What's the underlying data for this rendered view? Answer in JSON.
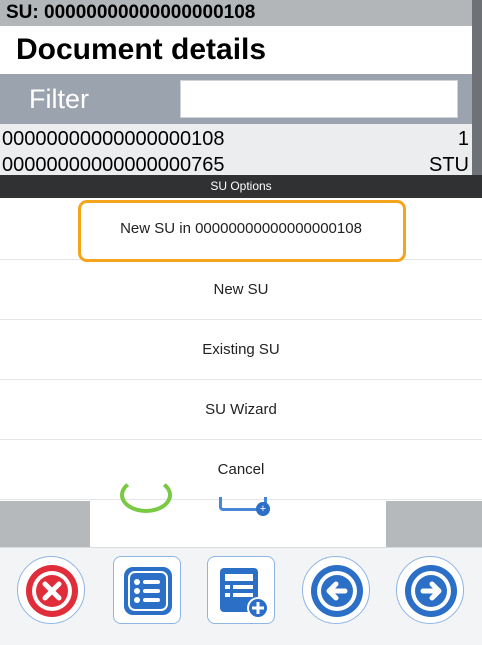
{
  "screen": {
    "su_label": "SU: 00000000000000000108",
    "title": "Document details",
    "filter_label": "Filter",
    "filter_value": "",
    "rows": [
      {
        "id": "00000000000000000108",
        "qty": "1"
      },
      {
        "id": "00000000000000000765",
        "qty": "STU"
      }
    ]
  },
  "dialog": {
    "header": "SU Options",
    "options": [
      {
        "label": "New SU in 00000000000000000108",
        "focused": true
      },
      {
        "label": "New SU"
      },
      {
        "label": "Existing SU"
      },
      {
        "label": "SU Wizard"
      },
      {
        "label": "Cancel"
      }
    ],
    "focus_color": "#f4a51d"
  },
  "toolbar": {
    "buttons": [
      {
        "icon": "cancel-icon",
        "color": "#e02d39"
      },
      {
        "icon": "list-icon",
        "color": "#2c6fc7"
      },
      {
        "icon": "add-document-icon",
        "color": "#2c6fc7"
      },
      {
        "icon": "arrow-left-icon",
        "color": "#2c6fc7"
      },
      {
        "icon": "arrow-right-icon",
        "color": "#2c6fc7"
      }
    ]
  }
}
